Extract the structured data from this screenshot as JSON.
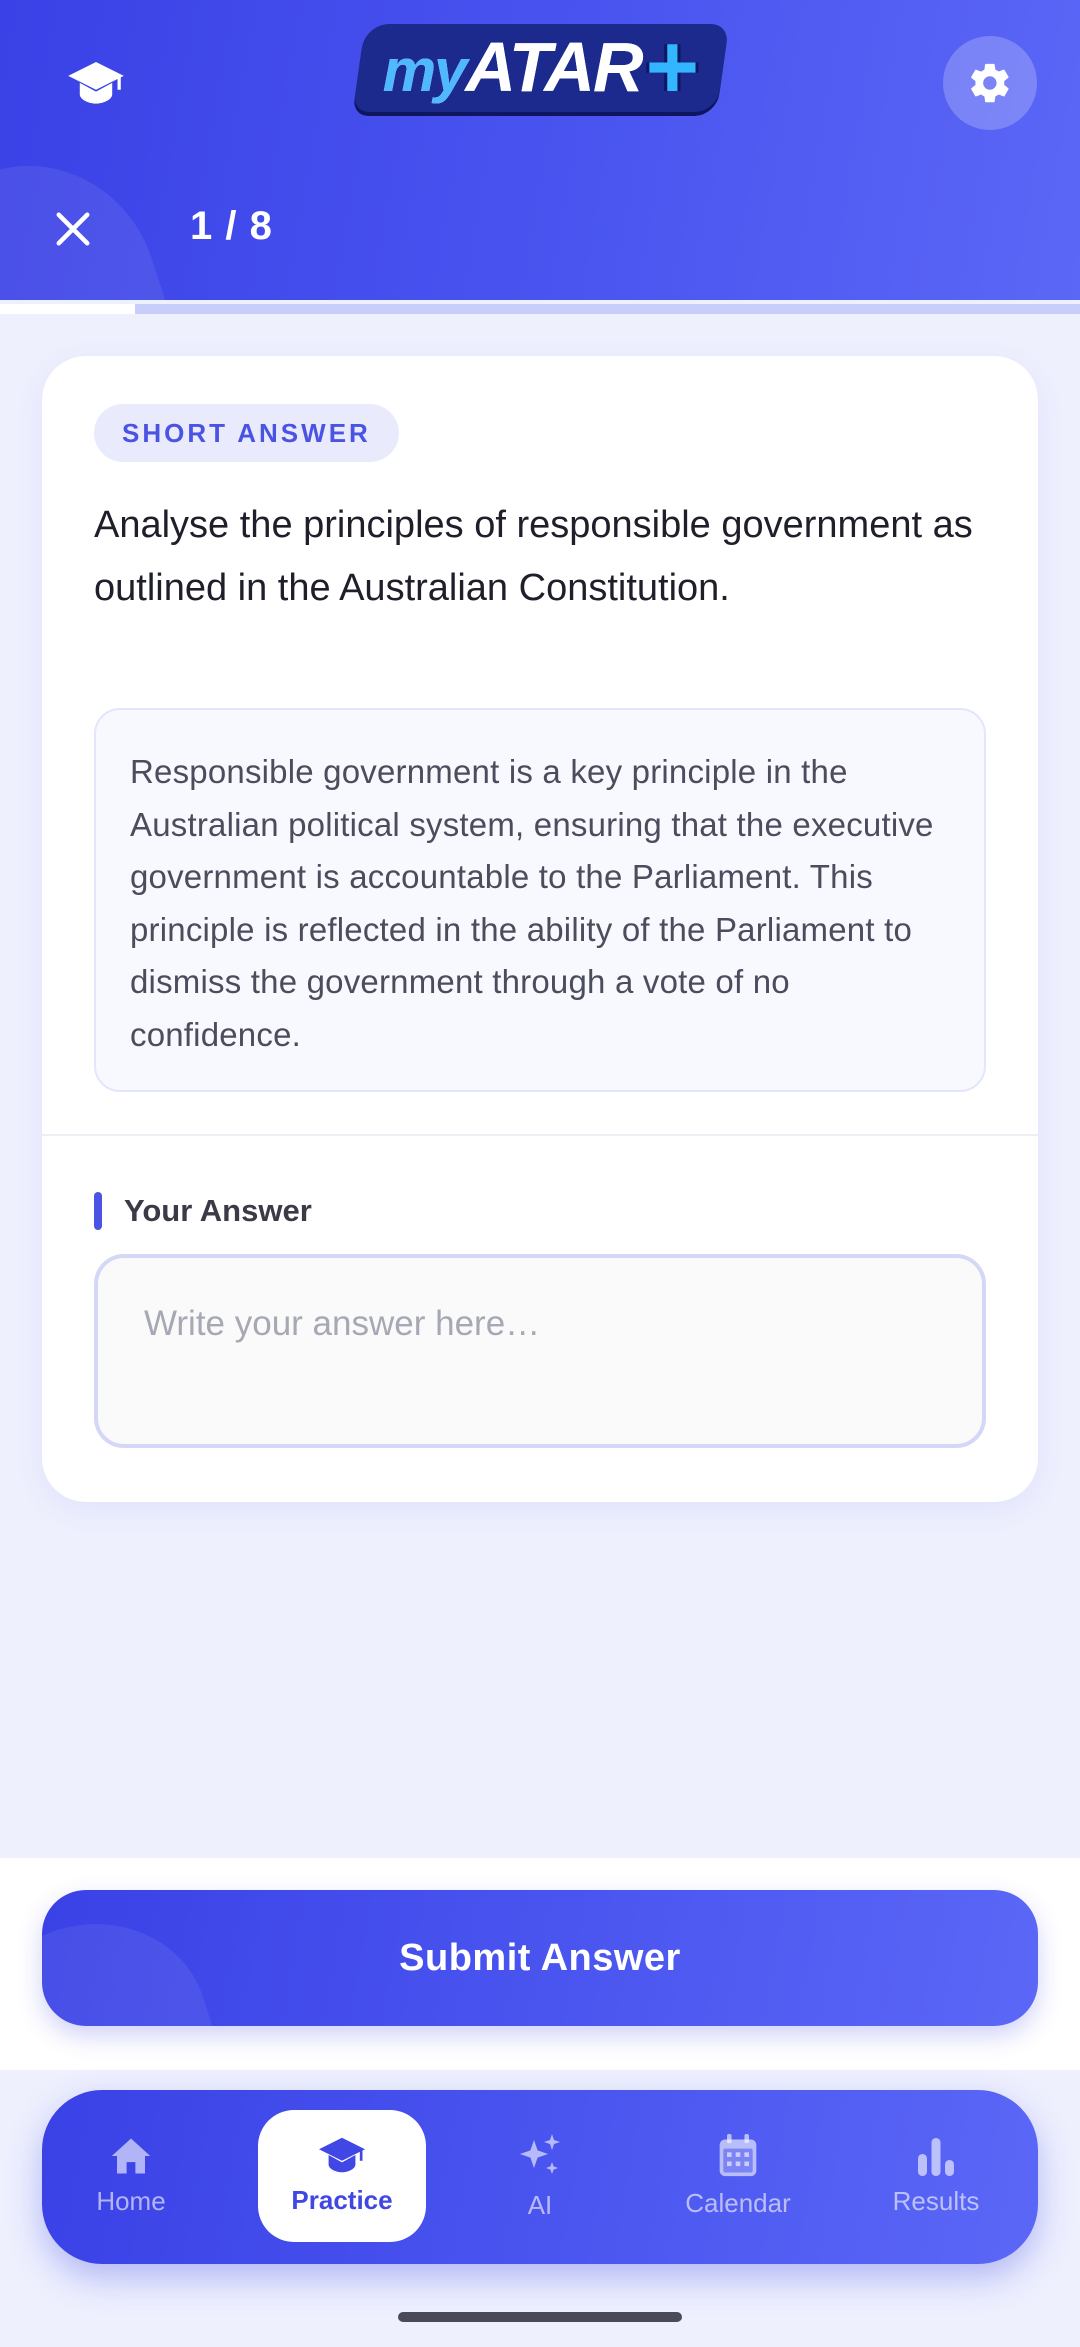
{
  "header": {
    "logo": {
      "prefix": "my",
      "name": "ATAR",
      "suffix": "+"
    },
    "counter": "1 / 8",
    "progress": 0.125,
    "icons": {
      "left": "graduation-cap-icon",
      "right": "gear-icon",
      "close": "close-icon"
    }
  },
  "question": {
    "type_badge": "SHORT ANSWER",
    "prompt": "Analyse the principles of responsible government as outlined in the Australian Constitution.",
    "context": "Responsible government is a key principle in the Australian political system, ensuring that the executive government is accountable to the Parliament. This principle is reflected in the ability of the Parliament to dismiss the government through a vote of no confidence."
  },
  "answer": {
    "label": "Your Answer",
    "placeholder": "Write your answer here…",
    "value": ""
  },
  "submit": {
    "label": "Submit Answer"
  },
  "nav": {
    "items": [
      {
        "label": "Home",
        "icon": "home-icon",
        "active": false
      },
      {
        "label": "Practice",
        "icon": "graduation-cap-icon",
        "active": true
      },
      {
        "label": "AI",
        "icon": "sparkle-icon",
        "active": false
      },
      {
        "label": "Calendar",
        "icon": "calendar-icon",
        "active": false
      },
      {
        "label": "Results",
        "icon": "bar-chart-icon",
        "active": false
      }
    ]
  },
  "colors": {
    "primary": "#3a41e6",
    "primary_light": "#5b67f6",
    "page_bg": "#eef0fe",
    "badge_text": "#4a53e2"
  }
}
